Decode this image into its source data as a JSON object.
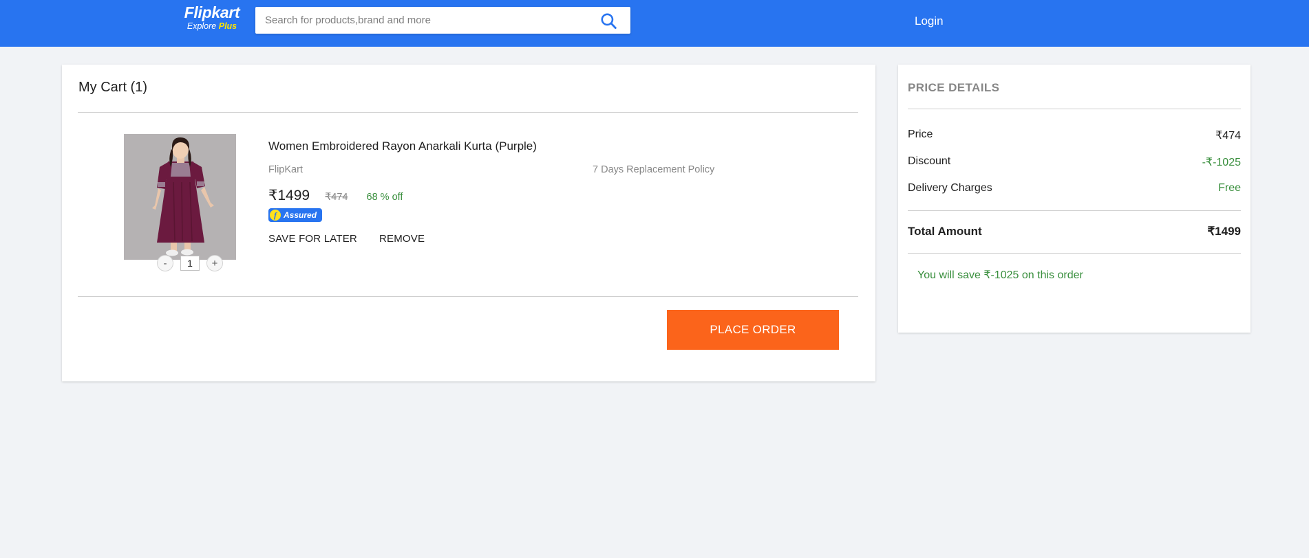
{
  "header": {
    "logo_main": "Flipkart",
    "logo_sub_explore": "Explore",
    "logo_sub_plus": "Plus",
    "search_placeholder": "Search for products,brand and more",
    "search_value": "",
    "search_icon": "search-icon",
    "login_label": "Login",
    "background_color": "#2874f0"
  },
  "cart": {
    "title": "My Cart (1)",
    "item": {
      "name": "Women Embroidered Rayon Anarkali Kurta (Purple)",
      "seller": "FlipKart",
      "replacement_policy": "7 Days Replacement Policy",
      "price_current": "₹1499",
      "price_original": "₹474",
      "discount_percent": "68 % off",
      "assured_label": "Assured",
      "quantity": "1",
      "decrement_label": "-",
      "increment_label": "+",
      "save_for_later_label": "SAVE FOR LATER",
      "remove_label": "REMOVE"
    },
    "place_order_label": "PLACE ORDER",
    "place_order_color": "#fb641b"
  },
  "price_details": {
    "title": "PRICE DETAILS",
    "rows": [
      {
        "label": "Price",
        "value": "₹474",
        "color": "#212121"
      },
      {
        "label": "Discount",
        "value": "-₹-1025",
        "color": "#388e3c"
      },
      {
        "label": "Delivery Charges",
        "value": "Free",
        "color": "#388e3c"
      }
    ],
    "total_label": "Total Amount",
    "total_value": "₹1499",
    "savings_text": "You will save ₹-1025 on this order",
    "savings_color": "#388e3c"
  }
}
